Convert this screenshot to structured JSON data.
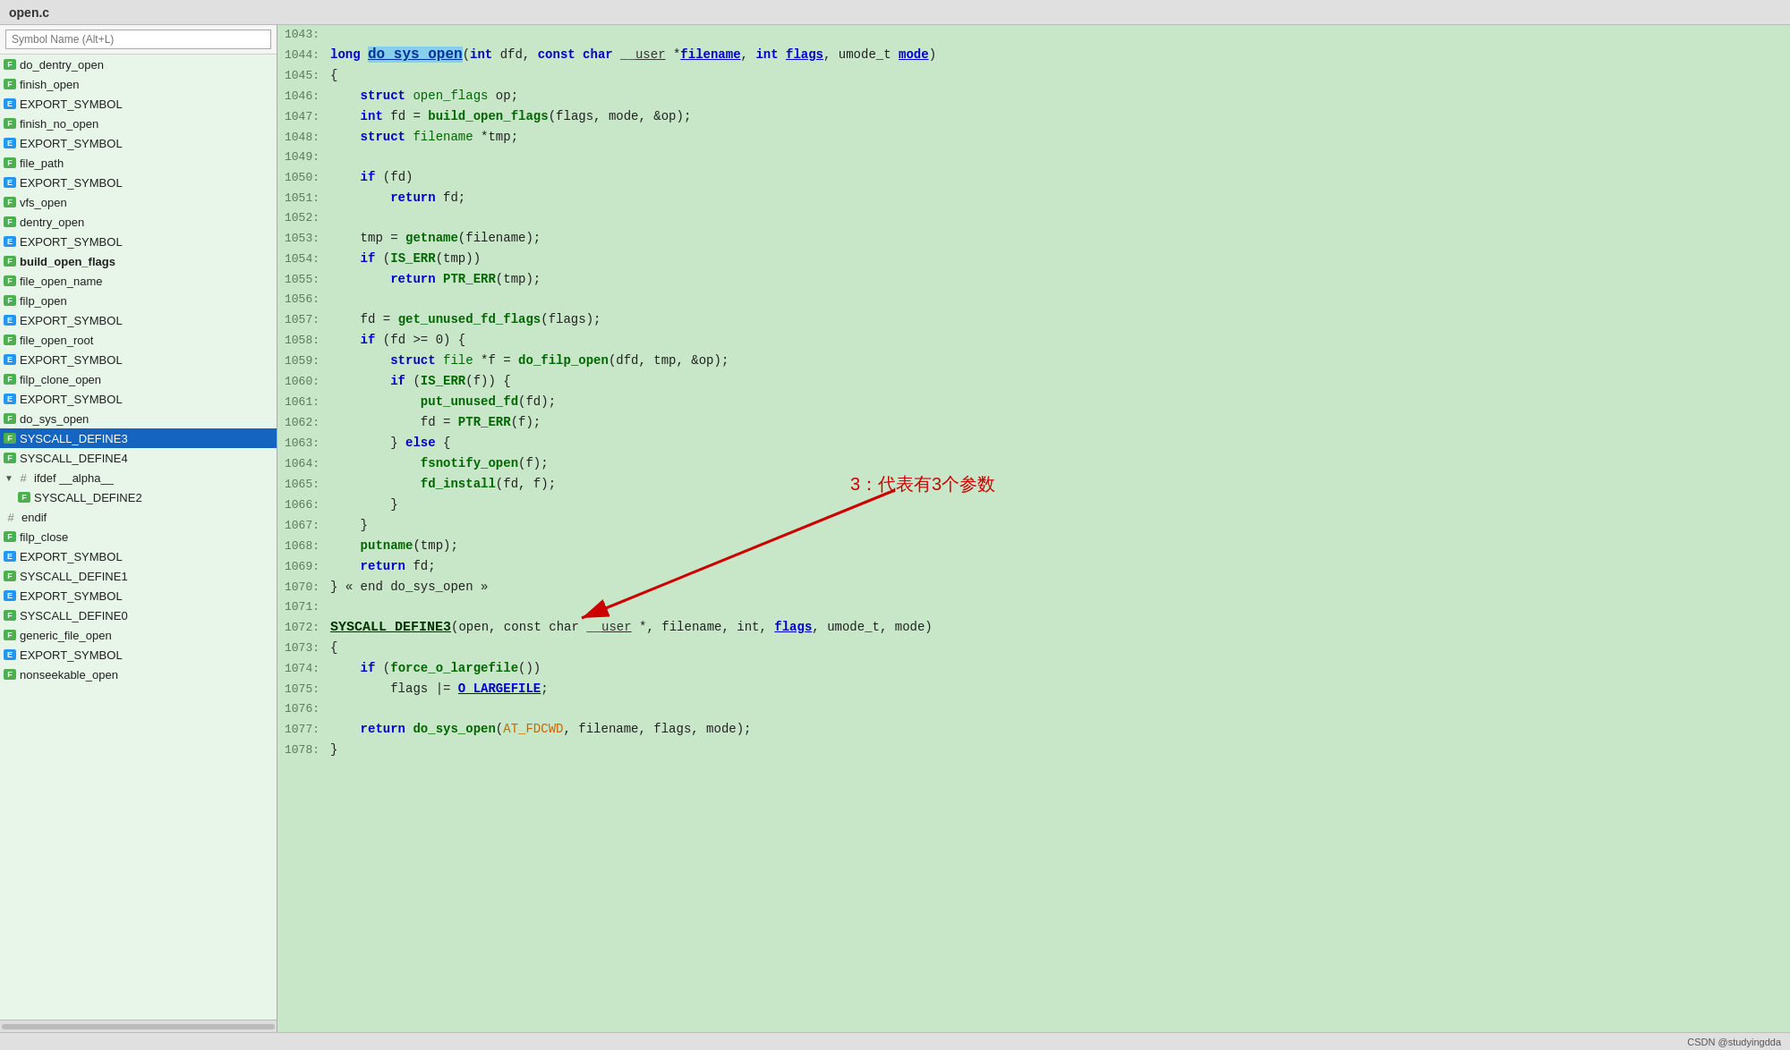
{
  "title": "open.c",
  "search": {
    "placeholder": "Symbol Name (Alt+L)"
  },
  "sidebar": {
    "items": [
      {
        "label": "do_dentry_open",
        "type": "func",
        "indent": 0,
        "selected": false
      },
      {
        "label": "finish_open",
        "type": "func",
        "indent": 0,
        "selected": false
      },
      {
        "label": "EXPORT_SYMBOL",
        "type": "export",
        "indent": 0,
        "selected": false
      },
      {
        "label": "finish_no_open",
        "type": "func",
        "indent": 0,
        "selected": false
      },
      {
        "label": "EXPORT_SYMBOL",
        "type": "export",
        "indent": 0,
        "selected": false
      },
      {
        "label": "file_path",
        "type": "func",
        "indent": 0,
        "selected": false
      },
      {
        "label": "EXPORT_SYMBOL",
        "type": "export",
        "indent": 0,
        "selected": false
      },
      {
        "label": "vfs_open",
        "type": "func",
        "indent": 0,
        "selected": false
      },
      {
        "label": "dentry_open",
        "type": "func",
        "indent": 0,
        "selected": false
      },
      {
        "label": "EXPORT_SYMBOL",
        "type": "export",
        "indent": 0,
        "selected": false
      },
      {
        "label": "build_open_flags",
        "type": "func",
        "indent": 0,
        "bold": true,
        "selected": false
      },
      {
        "label": "file_open_name",
        "type": "func",
        "indent": 0,
        "selected": false
      },
      {
        "label": "filp_open",
        "type": "func",
        "indent": 0,
        "selected": false
      },
      {
        "label": "EXPORT_SYMBOL",
        "type": "export",
        "indent": 0,
        "selected": false
      },
      {
        "label": "file_open_root",
        "type": "func",
        "indent": 0,
        "selected": false
      },
      {
        "label": "EXPORT_SYMBOL",
        "type": "export",
        "indent": 0,
        "selected": false
      },
      {
        "label": "filp_clone_open",
        "type": "func",
        "indent": 0,
        "selected": false
      },
      {
        "label": "EXPORT_SYMBOL",
        "type": "export",
        "indent": 0,
        "selected": false
      },
      {
        "label": "do_sys_open",
        "type": "func",
        "indent": 0,
        "selected": false
      },
      {
        "label": "SYSCALL_DEFINE3",
        "type": "func",
        "indent": 0,
        "selected": true
      },
      {
        "label": "SYSCALL_DEFINE4",
        "type": "func",
        "indent": 0,
        "selected": false
      },
      {
        "label": "ifdef __alpha__",
        "type": "hash",
        "indent": 0,
        "selected": false,
        "expand": true
      },
      {
        "label": "SYSCALL_DEFINE2",
        "type": "func",
        "indent": 1,
        "selected": false
      },
      {
        "label": "endif",
        "type": "hash",
        "indent": 0,
        "selected": false
      },
      {
        "label": "filp_close",
        "type": "func",
        "indent": 0,
        "selected": false
      },
      {
        "label": "EXPORT_SYMBOL",
        "type": "export",
        "indent": 0,
        "selected": false
      },
      {
        "label": "SYSCALL_DEFINE1",
        "type": "func",
        "indent": 0,
        "selected": false
      },
      {
        "label": "EXPORT_SYMBOL",
        "type": "export",
        "indent": 0,
        "selected": false
      },
      {
        "label": "SYSCALL_DEFINE0",
        "type": "func",
        "indent": 0,
        "selected": false
      },
      {
        "label": "generic_file_open",
        "type": "func",
        "indent": 0,
        "selected": false
      },
      {
        "label": "EXPORT_SYMBOL",
        "type": "export",
        "indent": 0,
        "selected": false
      },
      {
        "label": "nonseekable_open",
        "type": "func",
        "indent": 0,
        "selected": false
      }
    ]
  },
  "code": {
    "lines": [
      {
        "num": "1043:",
        "content": ""
      },
      {
        "num": "1044:",
        "content": "LONG_DO_SYS_OPEN"
      },
      {
        "num": "1045:",
        "content": "{"
      },
      {
        "num": "1046:",
        "content": "    struct open_flags op;"
      },
      {
        "num": "1047:",
        "content": "    int fd = build_open_flags(flags, mode, &op);"
      },
      {
        "num": "1048:",
        "content": "    struct filename *tmp;"
      },
      {
        "num": "1049:",
        "content": ""
      },
      {
        "num": "1050:",
        "content": "    if (fd)"
      },
      {
        "num": "1051:",
        "content": "        return fd;"
      },
      {
        "num": "1052:",
        "content": ""
      },
      {
        "num": "1053:",
        "content": "    tmp = getname(filename);"
      },
      {
        "num": "1054:",
        "content": "    if (IS_ERR(tmp))"
      },
      {
        "num": "1055:",
        "content": "        return PTR_ERR(tmp);"
      },
      {
        "num": "1056:",
        "content": ""
      },
      {
        "num": "1057:",
        "content": "    fd = get_unused_fd_flags(flags);"
      },
      {
        "num": "1058:",
        "content": "    if (fd >= 0) {"
      },
      {
        "num": "1059:",
        "content": "        struct file *f = do_filp_open(dfd, tmp, &op);"
      },
      {
        "num": "1060:",
        "content": "        if (IS_ERR(f)) {"
      },
      {
        "num": "1061:",
        "content": "            put_unused_fd(fd);"
      },
      {
        "num": "1062:",
        "content": "            fd = PTR_ERR(f);"
      },
      {
        "num": "1063:",
        "content": "        } else {"
      },
      {
        "num": "1064:",
        "content": "            fsnotify_open(f);"
      },
      {
        "num": "1065:",
        "content": "            fd_install(fd, f);"
      },
      {
        "num": "1066:",
        "content": "        }"
      },
      {
        "num": "1067:",
        "content": "    }"
      },
      {
        "num": "1068:",
        "content": "    putname(tmp);"
      },
      {
        "num": "1069:",
        "content": "    return fd;"
      },
      {
        "num": "1070:",
        "content": "} « end do_sys_open »"
      },
      {
        "num": "1071:",
        "content": ""
      },
      {
        "num": "1072:",
        "content": "SYSCALL_DEFINE3"
      },
      {
        "num": "1073:",
        "content": "{"
      },
      {
        "num": "1074:",
        "content": "    if (force_o_largefile())"
      },
      {
        "num": "1075:",
        "content": "        flags |= O_LARGEFILE;"
      },
      {
        "num": "1076:",
        "content": ""
      },
      {
        "num": "1077:",
        "content": "    return do_sys_open(AT_FDCWD, filename, flags, mode);"
      },
      {
        "num": "1078:",
        "content": "}"
      }
    ],
    "annotation": {
      "text": "3：代表有3个参数",
      "color": "#cc0000"
    }
  },
  "status_bar": {
    "label": "CSDN @studyingdda"
  }
}
